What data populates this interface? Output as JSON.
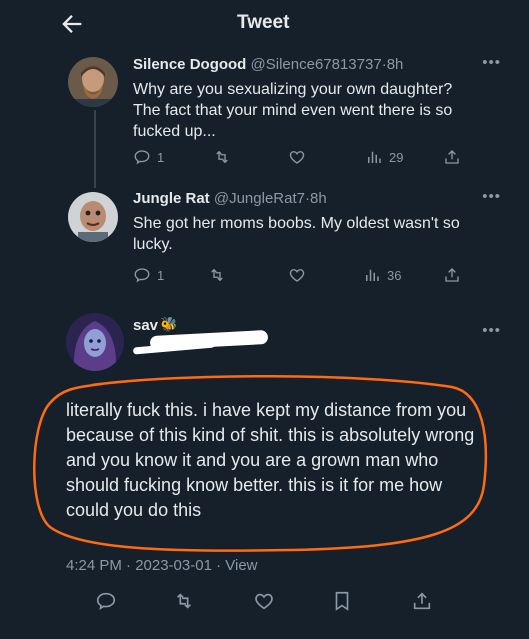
{
  "header": {
    "title": "Tweet"
  },
  "tweets": [
    {
      "name": "Silence Dogood",
      "handle": "@Silence67813737",
      "sep": "·",
      "time": "8h",
      "text": "Why are you sexualizing your own daughter? The fact that your mind even went there is so fucked up...",
      "replies": "1",
      "retweets": "",
      "likes": "",
      "views": "29"
    },
    {
      "name": "Jungle Rat",
      "handle": "@JungleRat7",
      "sep": "·",
      "time": "8h",
      "text": "She got her moms boobs. My oldest wasn't so lucky.",
      "replies": "1",
      "retweets": "",
      "likes": "",
      "views": "36"
    }
  ],
  "main_tweet": {
    "name": "sav",
    "emoji": "🐝",
    "text": "literally fuck this. i have kept my distance from you because of this kind of shit. this is absolutely wrong and you know it and you are a grown man who should fucking know better. this is it for me how could you do this",
    "timestamp": "4:24 PM · 2023-03-01 · View"
  },
  "colors": {
    "background": "#15202b",
    "text": "#e7e9ea",
    "muted": "#8b98a5",
    "annotation": "#ff6a13"
  }
}
